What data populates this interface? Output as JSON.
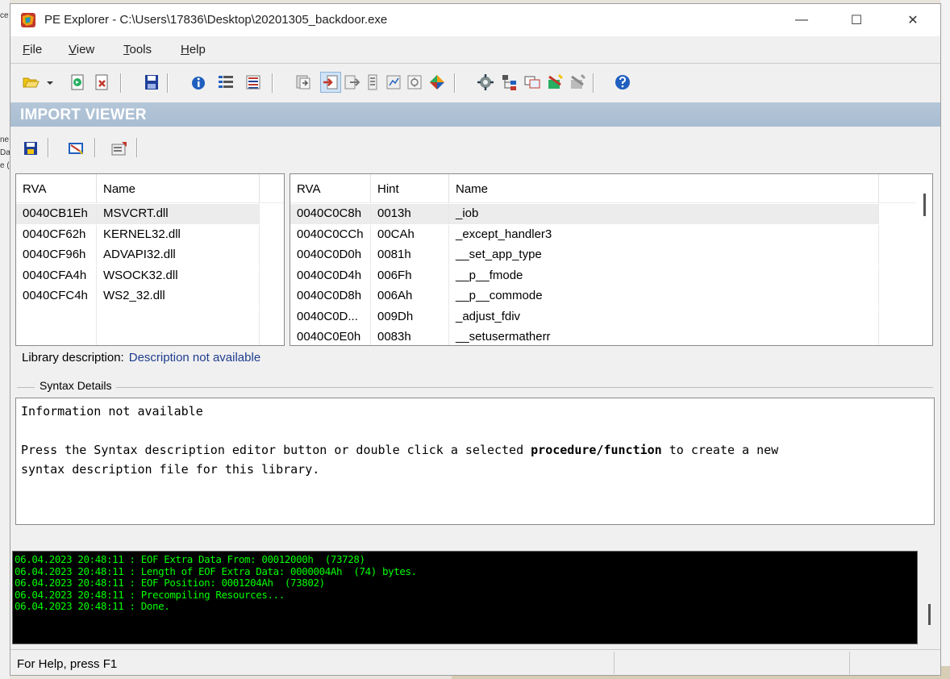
{
  "window": {
    "title": "PE Explorer - C:\\Users\\17836\\Desktop\\20201305_backdoor.exe",
    "min_glyph": "—",
    "max_glyph": "☐",
    "close_glyph": "✕"
  },
  "background": {
    "frag1": "ce",
    "frag2": "ne",
    "frag3": "Da",
    "frag4": "e ("
  },
  "menu": {
    "file": {
      "mnemonic": "F",
      "rest": "ile"
    },
    "view": {
      "mnemonic": "V",
      "rest": "iew"
    },
    "tools": {
      "mnemonic": "T",
      "rest": "ools"
    },
    "help": {
      "mnemonic": "H",
      "rest": "elp"
    }
  },
  "section": {
    "title": "IMPORT VIEWER"
  },
  "dll_list": {
    "headers": [
      "RVA",
      "Name"
    ],
    "rows": [
      [
        "0040CB1Eh",
        "MSVCRT.dll"
      ],
      [
        "0040CF62h",
        "KERNEL32.dll"
      ],
      [
        "0040CF96h",
        "ADVAPI32.dll"
      ],
      [
        "0040CFA4h",
        "WSOCK32.dll"
      ],
      [
        "0040CFC4h",
        "WS2_32.dll"
      ]
    ]
  },
  "func_list": {
    "headers": [
      "RVA",
      "Hint",
      "Name"
    ],
    "rows": [
      [
        "0040C0C8h",
        "0013h",
        "_iob"
      ],
      [
        "0040C0CCh",
        "00CAh",
        "_except_handler3"
      ],
      [
        "0040C0D0h",
        "0081h",
        "__set_app_type"
      ],
      [
        "0040C0D4h",
        "006Fh",
        "__p__fmode"
      ],
      [
        "0040C0D8h",
        "006Ah",
        "__p__commode"
      ],
      [
        "0040C0D...",
        "009Dh",
        "_adjust_fdiv"
      ],
      [
        "0040C0E0h",
        "0083h",
        "__setusermatherr"
      ]
    ]
  },
  "library_description": {
    "label": "Library description:",
    "value": "Description not available"
  },
  "syntax": {
    "group_label": "Syntax Details",
    "line1": "Information not available",
    "line2_pre": "Press the Syntax description editor button or double click a selected ",
    "line2_bold": "procedure/function",
    "line2_post": " to create a new\nsyntax description file for this library."
  },
  "log": {
    "lines": [
      "06.04.2023 20:48:11 : EOF Extra Data From: 00012000h  (73728)",
      "06.04.2023 20:48:11 : Length of EOF Extra Data: 0000004Ah  (74) bytes.",
      "06.04.2023 20:48:11 : EOF Position: 0001204Ah  (73802)",
      "06.04.2023 20:48:11 : Precompiling Resources...",
      "06.04.2023 20:48:11 : Done."
    ]
  },
  "status": {
    "text": "For Help, press F1"
  }
}
